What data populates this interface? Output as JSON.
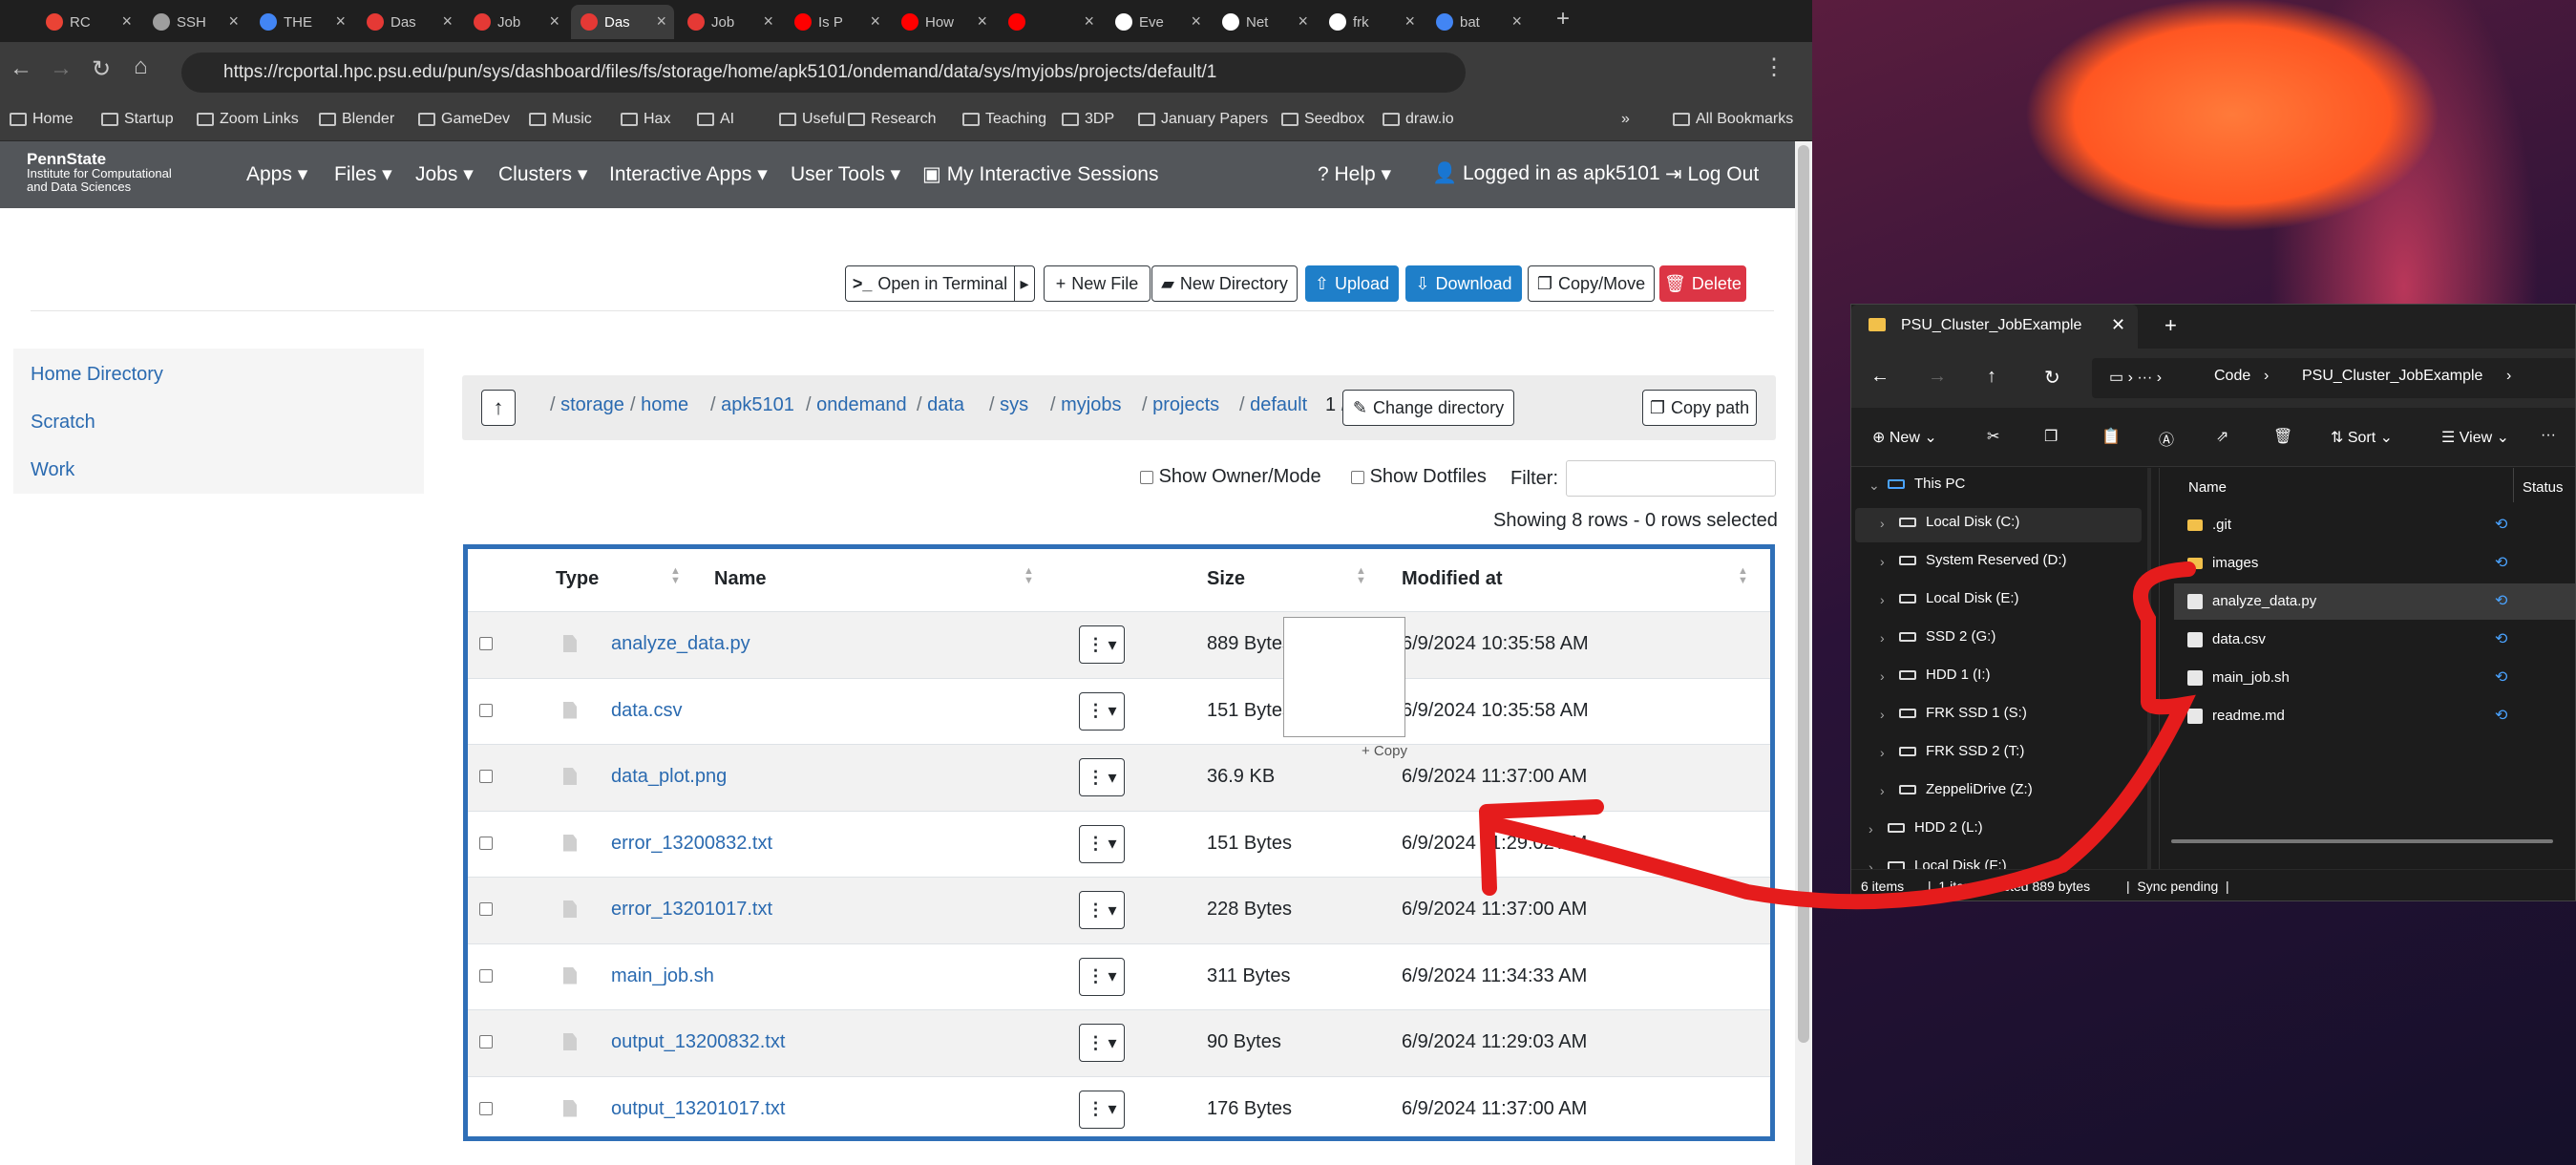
{
  "browser": {
    "tabs": [
      {
        "label": "RC",
        "color": "#ea4335"
      },
      {
        "label": "SSH",
        "color": "#9e9e9e"
      },
      {
        "label": "THE",
        "color": "#4285f4"
      },
      {
        "label": "Das",
        "color": "#e53935"
      },
      {
        "label": "Job",
        "color": "#e53935"
      },
      {
        "label": "Das",
        "color": "#e53935",
        "active": true
      },
      {
        "label": "Job",
        "color": "#e53935"
      },
      {
        "label": "Is P",
        "color": "#ff0000"
      },
      {
        "label": "How",
        "color": "#ff0000"
      },
      {
        "label": "",
        "color": "#ff0000"
      },
      {
        "label": "Eve",
        "color": "#ffffff"
      },
      {
        "label": "Net",
        "color": "#ffffff"
      },
      {
        "label": "frk",
        "color": "#ffffff"
      },
      {
        "label": "bat",
        "color": "#4285f4"
      }
    ],
    "url": "https://rcportal.hpc.psu.edu/pun/sys/dashboard/files/fs/storage/home/apk5101/ondemand/data/sys/myjobs/projects/default/1",
    "bookmarks": [
      "Home",
      "Startup",
      "Zoom Links",
      "Blender",
      "GameDev",
      "Music",
      "Hax",
      "AI",
      "Useful",
      "Research",
      "Teaching",
      "3DP",
      "January Papers",
      "Seedbox",
      "draw.io"
    ],
    "all_bookmarks": "All Bookmarks",
    "overflow": "»"
  },
  "portal": {
    "logo_line1": "PennState",
    "logo_line2": "Institute for Computational",
    "logo_line3": "and Data Sciences",
    "nav": [
      "Apps",
      "Files",
      "Jobs",
      "Clusters",
      "Interactive Apps",
      "User Tools",
      "My Interactive Sessions"
    ],
    "help": "Help",
    "logged_in": "Logged in as apk5101",
    "logout": "Log Out"
  },
  "actions": {
    "open_terminal": "Open in Terminal",
    "new_file": "New File",
    "new_directory": "New Directory",
    "upload": "Upload",
    "download": "Download",
    "copy_move": "Copy/Move",
    "delete": "Delete"
  },
  "sidebar": [
    "Home Directory",
    "Scratch",
    "Work"
  ],
  "breadcrumb": [
    "storage",
    "home",
    "apk5101",
    "ondemand",
    "data",
    "sys",
    "myjobs",
    "projects",
    "default"
  ],
  "breadcrumb_current": "1",
  "change_directory": "Change directory",
  "copy_path": "Copy path",
  "filters": {
    "show_owner": "Show Owner/Mode",
    "show_dotfiles": "Show Dotfiles",
    "filter_label": "Filter:",
    "filter_value": "",
    "showing": "Showing 8 rows - 0 rows selected"
  },
  "table": {
    "headers": [
      "Type",
      "Name",
      "Size",
      "Modified at"
    ],
    "rows": [
      {
        "name": "analyze_data.py",
        "size": "889 Bytes",
        "modified": "6/9/2024 10:35:58 AM"
      },
      {
        "name": "data.csv",
        "size": "151 Bytes",
        "modified": "6/9/2024 10:35:58 AM"
      },
      {
        "name": "data_plot.png",
        "size": "36.9 KB",
        "modified": "6/9/2024 11:37:00 AM"
      },
      {
        "name": "error_13200832.txt",
        "size": "151 Bytes",
        "modified": "6/9/2024 11:29:02 AM"
      },
      {
        "name": "error_13201017.txt",
        "size": "228 Bytes",
        "modified": "6/9/2024 11:37:00 AM"
      },
      {
        "name": "main_job.sh",
        "size": "311 Bytes",
        "modified": "6/9/2024 11:34:33 AM"
      },
      {
        "name": "output_13200832.txt",
        "size": "90 Bytes",
        "modified": "6/9/2024 11:29:03 AM"
      },
      {
        "name": "output_13201017.txt",
        "size": "176 Bytes",
        "modified": "6/9/2024 11:37:00 AM"
      }
    ]
  },
  "drag_tip": "+ Copy",
  "explorer": {
    "tab_title": "PSU_Cluster_JobExample",
    "path": [
      "Code",
      "PSU_Cluster_JobExample"
    ],
    "cmd": {
      "new": "New",
      "sort": "Sort",
      "view": "View"
    },
    "tree": [
      "This PC",
      "Local Disk (C:)",
      "System Reserved (D:)",
      "Local Disk (E:)",
      "SSD 2 (G:)",
      "HDD 1 (I:)",
      "FRK SSD 1 (S:)",
      "FRK SSD 2 (T:)",
      "ZeppeliDrive (Z:)",
      "HDD 2 (L:)",
      "Local Disk (F:)"
    ],
    "col_name": "Name",
    "col_status": "Status",
    "files": [
      ".git",
      "images",
      "analyze_data.py",
      "data.csv",
      "main_job.sh",
      "readme.md"
    ],
    "status_items": "6 items",
    "status_selected": "1 item selected  889 bytes",
    "status_sync": "Sync pending"
  },
  "colors": {
    "annotation": "#e51c1c",
    "primary": "#1f7fc9",
    "danger": "#dc3545",
    "nav": "#53565a"
  }
}
